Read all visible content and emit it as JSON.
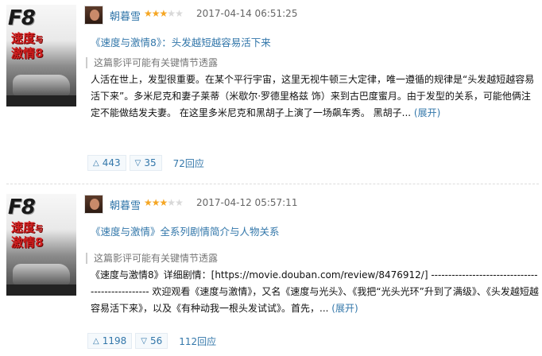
{
  "reviews": [
    {
      "poster": {
        "brand": "F8",
        "title_line1": "速度",
        "title_mark": "与",
        "title_line2": "激情8"
      },
      "author": "朝暮雪",
      "rating": 3,
      "time": "2017-04-14 06:51:25",
      "title": "《速度与激情8》：头发越短越容易活下来",
      "spoiler_note": "这篇影评可能有关键情节透露",
      "summary": "人活在世上，发型很重要。在某个平行宇宙，这里无视牛顿三大定律，唯一遵循的规律是“头发越短越容易活下来”。多米尼克和妻子莱蒂（米歇尔·罗德里格兹 饰）来到古巴度蜜月。由于发型的关系，可能他俩注定不能做结发夫妻。 在这里多米尼克和黑胡子上演了一场飙车秀。 黑胡子...",
      "expand": "(展开)",
      "useful": "443",
      "useless": "35",
      "replies": "72回应"
    },
    {
      "poster": {
        "brand": "F8",
        "title_line1": "速度",
        "title_mark": "与",
        "title_line2": "激情8"
      },
      "author": "朝暮雪",
      "rating": 3,
      "time": "2017-04-12 05:57:11",
      "title": "《速度与激情》全系列剧情简介与人物关系",
      "spoiler_note": "这篇影评可能有关键情节透露",
      "summary": "《速度与激情8》详细剧情：[https://movie.douban.com/review/8476912/] ------------------------------------------------ 欢迎观看《速度与激情》，又名《速度与光头》、《我把“光头光环”升到了满级》、《头发越短越容易活下来》，以及《有种动我一根头发试试》。首先，...",
      "expand": "(展开)",
      "useful": "1198",
      "useless": "56",
      "replies": "112回应"
    }
  ],
  "icons": {
    "useful": "up-triangle-icon",
    "useless": "down-triangle-icon",
    "star": "star-icon"
  },
  "colors": {
    "link": "#3377aa",
    "star": "#f5a623",
    "muted": "#666666"
  }
}
